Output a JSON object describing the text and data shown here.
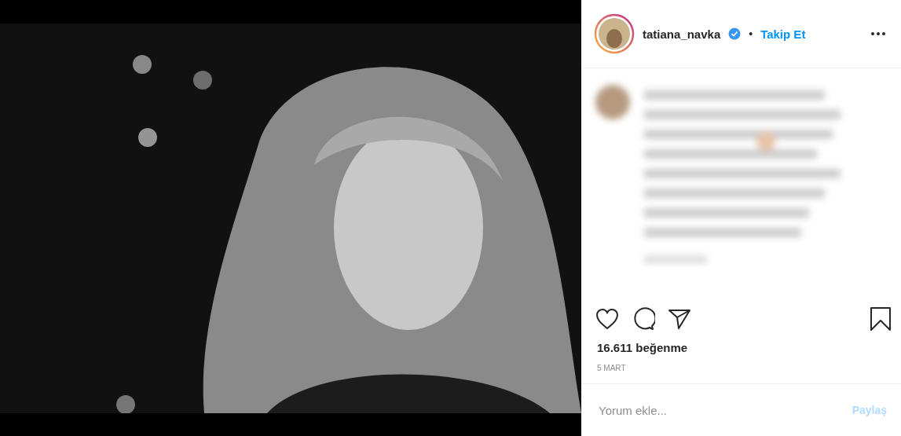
{
  "header": {
    "username": "tatiana_navka",
    "verified": true,
    "separator": "•",
    "follow": "Takip Et"
  },
  "caption": {
    "blurred": true
  },
  "actions": {
    "liked": false,
    "saved": false
  },
  "likes": "16.611 beğenme",
  "date": "5 MART",
  "comment": {
    "placeholder": "Yorum ekle...",
    "post_button": "Paylaş",
    "disabled": true
  }
}
